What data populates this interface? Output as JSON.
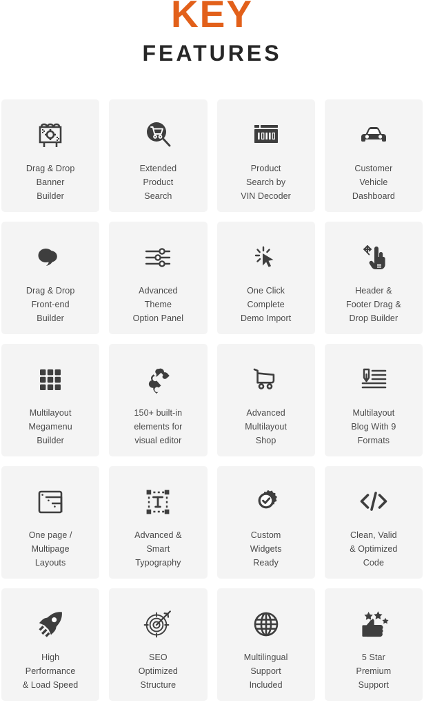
{
  "header": {
    "title_primary": "KEY",
    "title_secondary": "FEATURES",
    "primary_color": "#e2601a",
    "secondary_color": "#262626"
  },
  "theme": {
    "card_background": "#f4f4f4",
    "icon_color": "#3e3e3e",
    "label_color": "#4a4a4a",
    "page_background": "#ffffff"
  },
  "features": [
    {
      "icon": "banner-builder-icon",
      "label": "Drag & Drop\nBanner\nBuilder"
    },
    {
      "icon": "cart-search-icon",
      "label": "Extended\nProduct\nSearch"
    },
    {
      "icon": "vin-decoder-icon",
      "label": "Product\nSearch by\nVIN Decoder"
    },
    {
      "icon": "car-icon",
      "label": "Customer\nVehicle\nDashboard"
    },
    {
      "icon": "frontend-builder-icon",
      "label": "Drag & Drop\nFront-end\nBuilder"
    },
    {
      "icon": "sliders-icon",
      "label": "Advanced\nTheme\nOption Panel"
    },
    {
      "icon": "cursor-click-icon",
      "label": "One Click\nComplete\nDemo Import"
    },
    {
      "icon": "drag-hand-icon",
      "label": "Header &\nFooter Drag &\nDrop Builder"
    },
    {
      "icon": "grid-icon",
      "label": "Multilayout\nMegamenu\nBuilder"
    },
    {
      "icon": "puzzle-icon",
      "label": "150+ built-in\nelements for\nvisual editor"
    },
    {
      "icon": "shopping-cart-icon",
      "label": "Advanced\nMultilayout\nShop"
    },
    {
      "icon": "blog-list-icon",
      "label": "Multilayout\nBlog With 9\nFormats"
    },
    {
      "icon": "layout-icon",
      "label": "One page /\nMultipage\nLayouts"
    },
    {
      "icon": "typography-icon",
      "label": "Advanced &\nSmart\nTypography"
    },
    {
      "icon": "gear-check-icon",
      "label": "Custom\nWidgets\nReady"
    },
    {
      "icon": "code-icon",
      "label": "Clean, Valid\n& Optimized\nCode"
    },
    {
      "icon": "rocket-icon",
      "label": "High\nPerformance\n& Load Speed"
    },
    {
      "icon": "target-icon",
      "label": "SEO\nOptimized\nStructure"
    },
    {
      "icon": "globe-icon",
      "label": "Multilingual\nSupport\nIncluded"
    },
    {
      "icon": "thumbs-up-stars-icon",
      "label": "5 Star\nPremium\nSupport"
    }
  ],
  "icon_markup": {
    "banner-builder-icon": "<svg width='52' height='52' viewBox='0 0 52 52'><g fill='none' stroke='#3e3e3e' stroke-width='2.6'><path d='M11 14h30v22H11z'/><path d='M13 14c0-3 2-4 4-4s4 1 4 4'/><path d='M22 14c0-3 2-4 4-4s4 1 4 4'/><path d='M31 14c0-3 2-4 4-4s4 1 4 4'/><path d='M17 36v7M35 36v7'/><circle cx='26' cy='25' r='5'/><path d='M26 17v4M26 29v4M18 25h4M30 25h4'/></g><g fill='#3e3e3e'><rect x='14' y='17' width='2' height='2'/><rect x='16' y='19' width='2' height='2'/><rect x='14' y='21' width='2' height='2'/><rect x='35' y='28' width='2' height='2'/><rect x='37' y='30' width='2' height='2'/><rect x='35' y='32' width='2' height='2'/></g></svg>",
    "cart-search-icon": "<svg width='52' height='52' viewBox='0 0 52 52'><circle cx='24' cy='21' r='14' fill='#3e3e3e'/><g fill='none' stroke='#ffffff' stroke-width='1.9' stroke-linecap='round' stroke-linejoin='round'><path d='M16 14h2.6l2.6 10h9.4l2.4-7.4H19.6'/><circle cx='22' cy='28' r='1.9'/><circle cx='29.5' cy='28' r='1.9'/></g><path d='M34.2 31.5L43 41' stroke='#3e3e3e' stroke-width='2.8' stroke-linecap='round'/></svg>",
    "vin-decoder-icon": "<svg width='52' height='52' viewBox='0 0 52 52'><g fill='#3e3e3e'><rect x='9' y='11' width='7' height='4' rx='0.6'/><rect x='18' y='11' width='25' height='4' rx='0.6'/><rect x='9' y='17' width='34' height='20' rx='0.8'/></g><g fill='#ffffff'><rect x='14' y='22' width='2.6' height='10'/><rect x='19' y='22' width='4.4' height='10'/><rect x='25.4' y='22' width='2.6' height='10'/><rect x='30' y='22' width='2.6' height='10'/><rect x='34.6' y='22' width='4.4' height='10'/></g><g fill='#3e3e3e'><rect x='20.2' y='23.2' width='2' height='7.6'/><rect x='35.8' y='23.2' width='2' height='7.6'/></g></svg>",
    "car-icon": "<svg width='52' height='52' viewBox='0 0 52 52'><g fill='#3e3e3e'><path d='M8 28c0-2.2 1.8-4 4-4h2.6l3.6-7.2C19 15 20.6 14 22.4 14h7.2c1.8 0 3.4 1 4.2 2.8L37.4 24H40c2.2 0 4 1.8 4 4v5.4c0 .9-.7 1.6-1.6 1.6h-2.8c-.9 0-1.6-.7-1.6-1.6V32H14v1.4c0 .9-.7 1.6-1.6 1.6H9.6C8.7 35 8 34.3 8 33.4V28z'/></g><g fill='#ffffff'><path d='M19.6 18.4C20 17.6 20.8 17 21.8 17h8.4c1 0 1.8.6 2.2 1.4L34.6 24H17.4l2.2-5.6z'/><circle cx='16.4' cy='28' r='2.6'/><circle cx='35.6' cy='28' r='2.6'/></g></svg>",
    "frontend-builder-icon": "<svg width='52' height='52' viewBox='0 0 52 52'><g fill='#3e3e3e'><ellipse cx='19.5' cy='23' rx='11' ry='10'/><path d='M26 16c5.4 0 9.8 3.4 9.8 8.4 0 4-3 7.2-7.2 8.2-1.4 2.6-4.6 4.6-8.8 5.4 2.4-1.6 3.6-3.4 3.8-5.2-4.2-1-7.2-4.2-7.2-8.2 0-5 4.4-8.6 9.6-8.6z'/></g><path d='M28 32.8c-1.1 2.2-3.6 4-7.3 5 1.8-1.3 3-2.8 3.4-4.4' fill='#ffffff' opacity='0'/></svg>",
    "sliders-icon": "<svg width='52' height='52' viewBox='0 0 52 52'><g stroke='#3e3e3e' stroke-width='2.4' stroke-linecap='round' fill='none'><path d='M9 17h18M37 17h6'/><path d='M9 26h12M31 26h12'/><path d='M9 35h18M37 35h6'/></g><g fill='#ffffff' stroke='#3e3e3e' stroke-width='2.4'><circle cx='32' cy='17' r='3.6'/><circle cx='26' cy='26' r='3.6'/><circle cx='32' cy='35' r='3.6'/></g></svg>",
    "cursor-click-icon": "<svg width='52' height='52' viewBox='0 0 52 52'><g stroke='#3e3e3e' stroke-width='2.4' stroke-linecap='round'><path d='M22 11v5'/><path d='M13.5 14.5l3.2 3.6'/><path d='M11 23h5'/><path d='M13.5 31.5l3.6-3.4'/><path d='M30.6 14.6l-3.2 3.4'/></g><path d='M21 20l15.5 9.2-7 1.6 3.6 7.4-3.4 1.6-3.6-7.4-5.1 5.2z' fill='#3e3e3e'/></svg>",
    "drag-hand-icon": "<svg width='52' height='52' viewBox='0 0 52 52'><g stroke='#3e3e3e' stroke-width='1.9' stroke-linecap='round' stroke-linejoin='round' fill='#3e3e3e'><path d='M17 9v10M17 9l-2.4 2.6M17 9l2.4 2.6'/><path d='M17 19l-2.4-2.6M17 19l2.4 2.6'/><path d='M12 14h10M12 14l2.6-2.4M12 14l2.6 2.4'/><path d='M22 14l-2.6-2.4M22 14l-2.6 2.4'/></g><path d='M30 10c1.7 0 3 1.4 3 3v12h1v-4.4c0-1.5 1.2-2.6 2.6-2.6s2.6 1.1 2.6 2.6V25h.8c1.4 0 2.6 1.1 2.6 2.6v8.8c0 3.6-2.8 6.6-6.4 6.6h-7.6c-2.2 0-4.2-1.1-5.4-3L20 35c-.8-1.3-.4-3 .9-3.8 1.2-.8 2.8-.5 3.7.6l2.4 3V13c0-1.6 1.4-3 3-3z' fill='#3e3e3e'/><g fill='#ffffff'><rect x='31' y='36' width='6' height='1.6'/><rect x='31' y='39' width='6' height='1.6'/></g></svg>",
    "grid-icon": "<svg width='52' height='52' viewBox='0 0 52 52'><g fill='#3e3e3e'><rect x='11' y='11' width='8.4' height='8.4' rx='1.4'/><rect x='21.8' y='11' width='8.4' height='8.4' rx='1.4'/><rect x='32.6' y='11' width='8.4' height='8.4' rx='1.4'/><rect x='11' y='21.8' width='8.4' height='8.4' rx='1.4'/><rect x='21.8' y='21.8' width='8.4' height='8.4' rx='1.4'/><rect x='32.6' y='21.8' width='8.4' height='8.4' rx='1.4'/><rect x='11' y='32.6' width='8.4' height='8.4' rx='1.4'/><rect x='21.8' y='32.6' width='8.4' height='8.4' rx='1.4'/><rect x='32.6' y='32.6' width='8.4' height='8.4' rx='1.4'/></g></svg>",
    "puzzle-icon": "<svg width='52' height='52' viewBox='0 0 52 52'><path d='M29.4 9.6c3.4 0 5.8 2.6 5.6 5.6 1.8-.4 3.6.2 4.8 1.6l3 3.4-4 3.6c-1.6 1.4-4 1.4-5.4-.2-1.3-1.4-.9-3.3.3-4.4l-3.1-3.4-6.4 5.8c-1.2-1.2-3.2-1.4-4.6-.2-1.6 1.4-1.7 3.8-.3 5.4 1.3 1.5 3.4 1.7 4.9.6l6.3 7-3.4 3.1c-1.1-1.2-3.1-1.5-4.5-.2-1.6 1.4-1.8 3.9-.4 5.4 1.3 1.5 3.5 1.6 4.9.4l-3.3 3-3-3.4c-1.3-1.4-1.8-3.2-1.4-5-3 .5-5.8-1.5-6.4-4.4-.6-3 1.2-5.8 4-6.6-1.2-1.6-1.4-3.6-.4-5.3l2.8-3.2 3.4 3c1.2-1.2 1.6-3.1.4-4.5-1.4-1.6-1.2-3.9.4-5.3 1-.9 2.3-1.3 3.6-1.2z' fill='#3e3e3e'/></svg>",
    "shopping-cart-icon": "<svg width='52' height='52' viewBox='0 0 52 52'><g fill='none' stroke='#3e3e3e' stroke-width='2.6' stroke-linecap='round' stroke-linejoin='round'><path d='M9 11l4.6 1.8v17.4h20.2c1.7 0 3.1-1.4 3.1-3.1v-8.4L13.6 16.6'/><circle cx='19' cy='35.6' r='3'/><circle cx='31' cy='35.6' r='3'/></g></svg>",
    "blog-list-icon": "<svg width='52' height='52' viewBox='0 0 52 52'><g fill='none' stroke='#3e3e3e' stroke-width='2.6' stroke-linecap='round'><path d='M24 13h19M24 19h19M24 25h19'/><path d='M10 31h33M10 37h33'/></g><path d='M12 11h7v12l-3.5 5-3.5-5z' fill='none' stroke='#3e3e3e' stroke-width='2.4' stroke-linejoin='round'/><path d='M15.5 18v8' stroke='#3e3e3e' stroke-width='2.4' stroke-linecap='round'/></svg>",
    "layout-icon": "<svg width='52' height='52' viewBox='0 0 52 52'><g fill='none' stroke='#3e3e3e' stroke-width='2.6' stroke-linejoin='round'><rect x='10' y='11' width='32' height='30' rx='2.4'/><path d='M19 19h23v22'/><path d='M28 28h14v13'/></g><g fill='#3e3e3e'><circle cx='14.6' cy='15.6' r='1.3'/><circle cx='23.4' cy='23.8' r='1.3'/><circle cx='32.4' cy='32.6' r='1.3'/></g></svg>",
    "typography-icon": "<svg width='52' height='52' viewBox='0 0 52 52'><g stroke='#3e3e3e' stroke-width='2.4' stroke-dasharray='3 3.4' fill='none'><path d='M13 12h26M13 40h26M13 12v28M39 12v28'/></g><g fill='#3e3e3e'><rect x='9.6' y='8.6' width='6.6' height='6.6'/><rect x='35.8' y='8.6' width='6.6' height='6.6'/><rect x='9.6' y='36.8' width='6.6' height='6.6'/><rect x='35.8' y='36.8' width='6.6' height='6.6'/></g><g fill='none' stroke='#3e3e3e' stroke-width='2.8' stroke-linecap='round'><path d='M19.4 19h13.2'/><path d='M26 19v14'/><path d='M22.6 33h6.8'/></g></svg>",
    "gear-check-icon": "<svg width='52' height='52' viewBox='0 0 52 52'><path d='M26 8.5l3 1.2 2.8-1.9 2.1 2.8 3.4-.1.6 3.4 3.1 1.4-1.2 3.2 1.9 2.8-2.8 2.1.1 3.4-3.4.6-1.4 3.1-3.2-1.2-2.8 1.9-2.1-2.8-3.4.1-.6-3.4-3.1-1.4 1.2-3.2-1.9-2.8 2.8-2.1-.1-3.4 3.4-.6 1.4-3.1z' fill='#3e3e3e' transform='rotate(12 26 22)'/><circle cx='26' cy='24' r='11.4' fill='#3e3e3e'/><circle cx='26' cy='24' r='8.2' fill='#ffffff'/><path d='M21.6 24.2l3.1 3.2 6-6.6' fill='none' stroke='#3e3e3e' stroke-width='2.9' stroke-linecap='round' stroke-linejoin='round'/></svg>",
    "code-icon": "<svg width='52' height='52' viewBox='0 0 52 52'><g fill='none' stroke='#3e3e3e' stroke-width='3.6' stroke-linecap='round' stroke-linejoin='round'><path d='M17.5 16L8.5 25l9 9'/><path d='M34.5 16l9 9-9 9'/><path d='M29 13l-6 24'/></g></svg>",
    "rocket-icon": "<svg width='52' height='52' viewBox='0 0 52 52'><path d='M42.8 8.4c.6 6.4-1.2 12.6-5.2 17.6l-3 3.8c-.2 2.8-1.4 5.4-3.4 7.4l-4.2 4.2-3.4-7.6-6.2-6.2-7.6-3.4 4.2-4.2c2-2 4.6-3.2 7.4-3.4l3.8-3C30.2 9.6 36.4 7.8 42.8 8.4z' fill='#3e3e3e'/><circle cx='31.6' cy='19.6' r='3.6' fill='#ffffff'/><g fill='#3e3e3e'><path d='M9.4 33.2l5.2-5.2 2.4 2.4-5.2 5.2z'/><path d='M13 38.8l6.2-6.2 2.4 2.4-6.2 6.2z'/><path d='M18.4 42.4l4.8-4.8 2.4 2.4-4.8 4.8z'/></g></svg>",
    "target-icon": "<svg width='52' height='52' viewBox='0 0 52 52'><g fill='none' stroke='#3e3e3e' stroke-width='1.9'><circle cx='24' cy='27' r='14.4'/><circle cx='24' cy='27' r='9.4'/><circle cx='24' cy='27' r='4.6'/></g><g stroke='#3e3e3e' stroke-width='1.9' stroke-linecap='round'><path d='M24 9.6v5.2M24 39.2v5.2M6.6 27h5.2M36.2 27h5.2'/></g><g stroke='#3e3e3e' stroke-width='2.2' stroke-linecap='round' stroke-linejoin='round' fill='none'><path d='M24 27L40 11'/><path d='M35.6 10.2l4.8.6.6 4.8'/><path d='M40.4 10.8l3.4-3.4'/></g></svg>",
    "globe-icon": "<svg width='52' height='52' viewBox='0 0 52 52'><g fill='none' stroke='#3e3e3e' stroke-width='2.6'><circle cx='26' cy='26' r='16'/><ellipse cx='26' cy='26' rx='7' ry='16'/><path d='M11.4 19.4h29.2M11.4 32.6h29.2'/><path d='M10 26h32'/><path d='M26 10v32'/></g></svg>",
    "thumbs-up-stars-icon": "<svg width='52' height='52' viewBox='0 0 52 52'><g fill='#3e3e3e'><path d='M18.6 8l1.9 3.9 4.3.6-3.1 3 .7 4.3-3.8-2-3.8 2 .7-4.3-3.1-3 4.3-.6z'/><path d='M32.4 7.2l1.9 3.9 4.3.6-3.1 3 .7 4.3-3.8-2-3.8 2 .7-4.3-3.1-3 4.3-.6z'/><path d='M43 16.6l1.4 2.9 3.2.5-2.3 2.2.6 3.2-2.9-1.5-2.9 1.5.6-3.2-2.3-2.2 3.2-.5z'/></g><path d='M23.6 18c1.7 0 3.1 1.4 3.1 3.1V27h9.2c2 0 3.6 1.6 3.6 3.6 0 1-.4 1.9-1.1 2.6.7.6 1.1 1.5 1.1 2.5 0 1.1-.5 2.1-1.3 2.7.4.6.7 1.3.7 2.1 0 2-1.6 3.6-3.6 3.6H16.6c-1.1 0-2-.9-2-2V29.8c0-.8.3-1.5.8-2.1l5.3-6.1c.3-1 1.1-1.6 2-1.6h.9z' fill='#3e3e3e'/><rect x='9.4' y='27.4' width='7.6' height='16.6' rx='1.4' fill='#3e3e3e'/></svg>"
  }
}
